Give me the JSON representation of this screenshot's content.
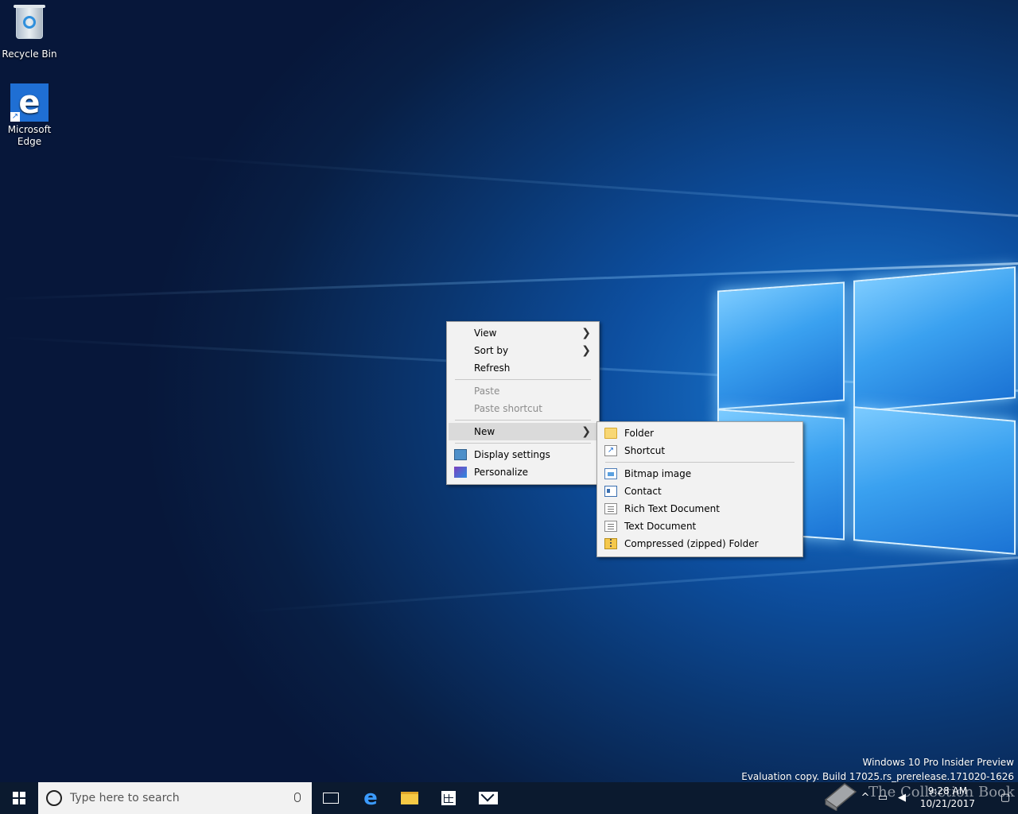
{
  "desktop": {
    "icons": [
      {
        "label": "Recycle Bin",
        "icon": "recycle-bin-icon"
      },
      {
        "label": "Microsoft Edge",
        "icon": "edge-icon"
      }
    ]
  },
  "context_menu": {
    "items": [
      {
        "label": "View",
        "submenu": true
      },
      {
        "label": "Sort by",
        "submenu": true
      },
      {
        "label": "Refresh"
      },
      {
        "label": "Paste",
        "disabled": true
      },
      {
        "label": "Paste shortcut",
        "disabled": true
      },
      {
        "label": "New",
        "submenu": true,
        "active": true
      },
      {
        "label": "Display settings",
        "icon": "display-settings-icon"
      },
      {
        "label": "Personalize",
        "icon": "personalize-icon"
      }
    ],
    "arrow_glyph": "❯"
  },
  "new_submenu": {
    "items": [
      {
        "label": "Folder",
        "icon": "folder-icon"
      },
      {
        "label": "Shortcut",
        "icon": "shortcut-icon"
      },
      {
        "label": "Bitmap image",
        "icon": "bitmap-icon"
      },
      {
        "label": "Contact",
        "icon": "contact-icon"
      },
      {
        "label": "Rich Text Document",
        "icon": "rich-text-icon"
      },
      {
        "label": "Text Document",
        "icon": "text-document-icon"
      },
      {
        "label": "Compressed (zipped) Folder",
        "icon": "zip-folder-icon"
      }
    ]
  },
  "watermark": {
    "line1": "Windows 10 Pro Insider Preview",
    "line2": "Evaluation copy. Build 17025.rs_prerelease.171020-1626"
  },
  "taskbar": {
    "search_placeholder": "Type here to search",
    "clock_time": "9:28 AM",
    "clock_date": "10/21/2017",
    "overlay_text": "The Collection Book"
  },
  "colors": {
    "taskbar_bg": "#0b1a2f",
    "menu_bg": "#f2f2f2",
    "menu_active": "#dadada"
  }
}
